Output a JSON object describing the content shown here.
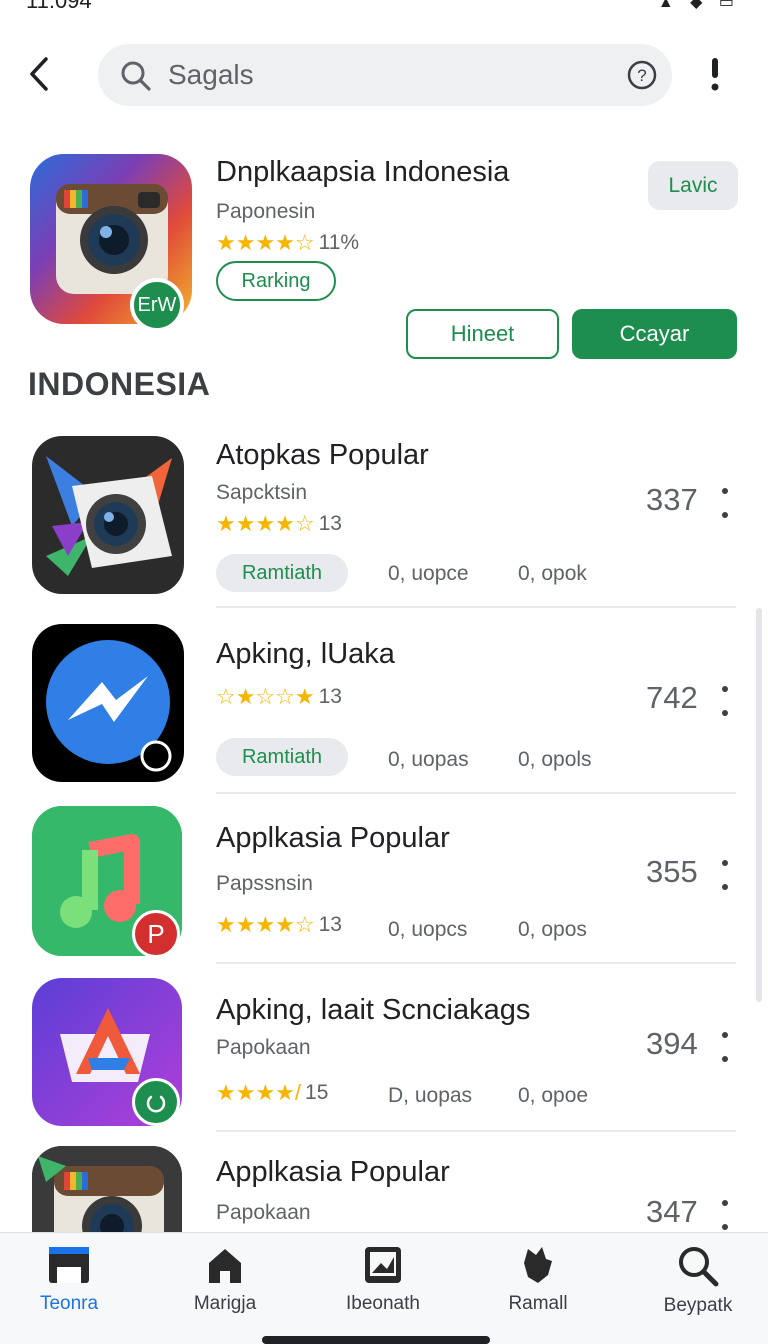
{
  "status_bar": {
    "time": "11:094",
    "icons": "▲ ◆ ▭"
  },
  "search": {
    "placeholder": "Sagals",
    "help_icon": "?"
  },
  "featured": {
    "title": "Dnplkaapsia Indonesia",
    "subtitle": "Paponesin",
    "stars": "★★★★☆",
    "rating_text": "11%",
    "chip_label": "Rarking",
    "badge_text": "ErW",
    "corner_button": "Lavic",
    "outline_button": "Hineet",
    "primary_button": "Ccayar"
  },
  "section_title": "INDONESIA",
  "apps": [
    {
      "title": "Atopkas Popular",
      "subtitle": "Sapcktsin",
      "stars": "★★★★☆",
      "rating": "13",
      "count": "337",
      "chip": "Ramtiath",
      "meta1": "0, uopce",
      "meta2": "0, opok"
    },
    {
      "title": "Apking, lUaka",
      "subtitle": "",
      "stars": "☆★☆☆★",
      "rating": "13",
      "count": "742",
      "chip": "Ramtiath",
      "meta1": "0, uopas",
      "meta2": "0, opols"
    },
    {
      "title": "Applkasia Popular",
      "subtitle": "Papssnsin",
      "stars": "★★★★☆",
      "rating": "13",
      "count": "355",
      "chip": "",
      "meta1": "0, uopcs",
      "meta2": "0, opos",
      "badge": "P"
    },
    {
      "title": "Apking, laait Scnciakags",
      "subtitle": "Papokaan",
      "stars": "★★★★/",
      "rating": "15",
      "count": "394",
      "chip": "",
      "meta1": "D, uopas",
      "meta2": "0, opoe"
    },
    {
      "title": "Applkasia Popular",
      "subtitle": "Papokaan",
      "stars": "",
      "rating": "",
      "count": "347",
      "chip": "",
      "meta1": "",
      "meta2": ""
    }
  ],
  "nav": [
    {
      "label": "Teonra",
      "icon": "store-icon",
      "active": true
    },
    {
      "label": "Marigja",
      "icon": "home-icon",
      "active": false
    },
    {
      "label": "Ibeonath",
      "icon": "image-icon",
      "active": false
    },
    {
      "label": "Ramall",
      "icon": "hand-icon",
      "active": false
    },
    {
      "label": "Beypatk",
      "icon": "search-icon",
      "active": false
    }
  ],
  "colors": {
    "accent_green": "#1e8e4e",
    "active_blue": "#1a73e8",
    "star": "#f6b600"
  }
}
